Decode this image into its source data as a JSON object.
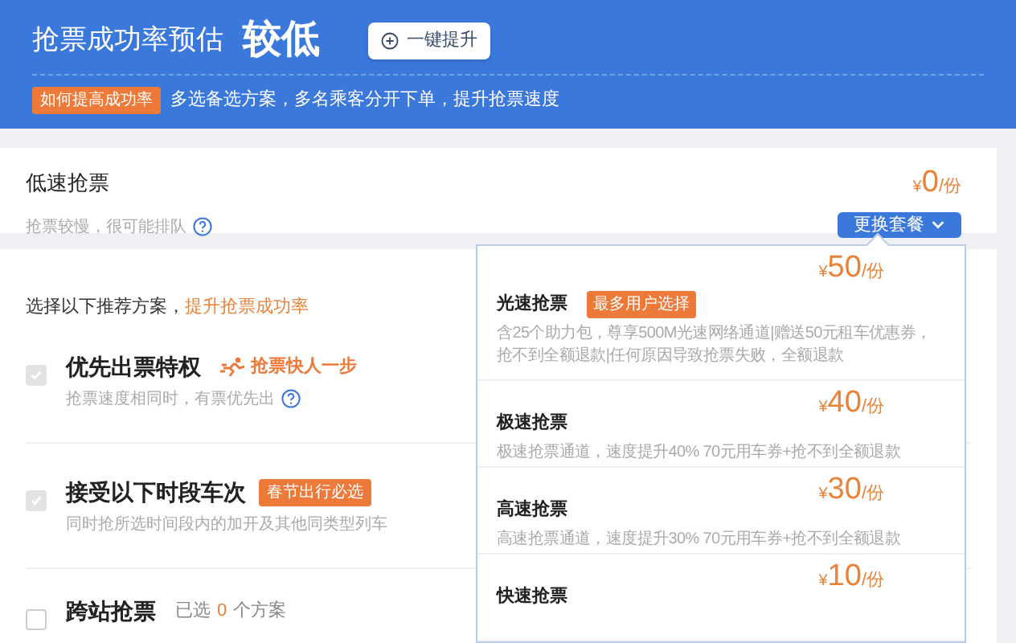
{
  "header": {
    "title": "抢票成功率预估",
    "rating": "较低",
    "boost_button": {
      "label": "一键提升"
    },
    "tip_badge": "如何提高成功率",
    "tip_text": "多选备选方案，多名乘客分开下单，提升抢票速度"
  },
  "current_plan": {
    "name": "低速抢票",
    "note": "抢票较慢，很可能排队",
    "price": {
      "currency": "¥",
      "amount": "0",
      "unit": "/份"
    },
    "change_button": {
      "label": "更换套餐",
      "expanded": true
    }
  },
  "recommend": {
    "intro": "选择以下推荐方案，",
    "intro_highlight": "提升抢票成功率",
    "options": [
      {
        "title": "优先出票特权",
        "badge": {
          "kind": "runner",
          "label": "抢票快人一步"
        },
        "description": "抢票速度相同时，有票优先出",
        "help": true,
        "checked": true
      },
      {
        "title": "接受以下时段车次",
        "badge": {
          "kind": "tag",
          "label": "春节出行必选"
        },
        "description": "同时抢所选时间段内的加开及其他同类型列车",
        "help": false,
        "checked": true
      },
      {
        "title": "跨站抢票",
        "selection": {
          "prefix": "已选",
          "count": "0",
          "suffix": "个方案"
        },
        "help": false,
        "checked": false
      }
    ]
  },
  "plan_menu": {
    "items": [
      {
        "name": "光速抢票",
        "badge": "最多用户选择",
        "description": "含25个助力包，尊享500M光速网络通道|赠送50元租车优惠券，抢不到全额退款|任何原因导致抢票失败，全额退款",
        "price": {
          "currency": "¥",
          "amount": "50",
          "unit": "/份"
        }
      },
      {
        "name": "极速抢票",
        "description": "极速抢票通道，速度提升40% 70元用车券+抢不到全额退款",
        "price": {
          "currency": "¥",
          "amount": "40",
          "unit": "/份"
        }
      },
      {
        "name": "高速抢票",
        "description": "高速抢票通道，速度提升30% 70元用车券+抢不到全额退款",
        "price": {
          "currency": "¥",
          "amount": "30",
          "unit": "/份"
        }
      },
      {
        "name": "快速抢票",
        "price": {
          "currency": "¥",
          "amount": "10",
          "unit": "/份"
        }
      }
    ]
  }
}
